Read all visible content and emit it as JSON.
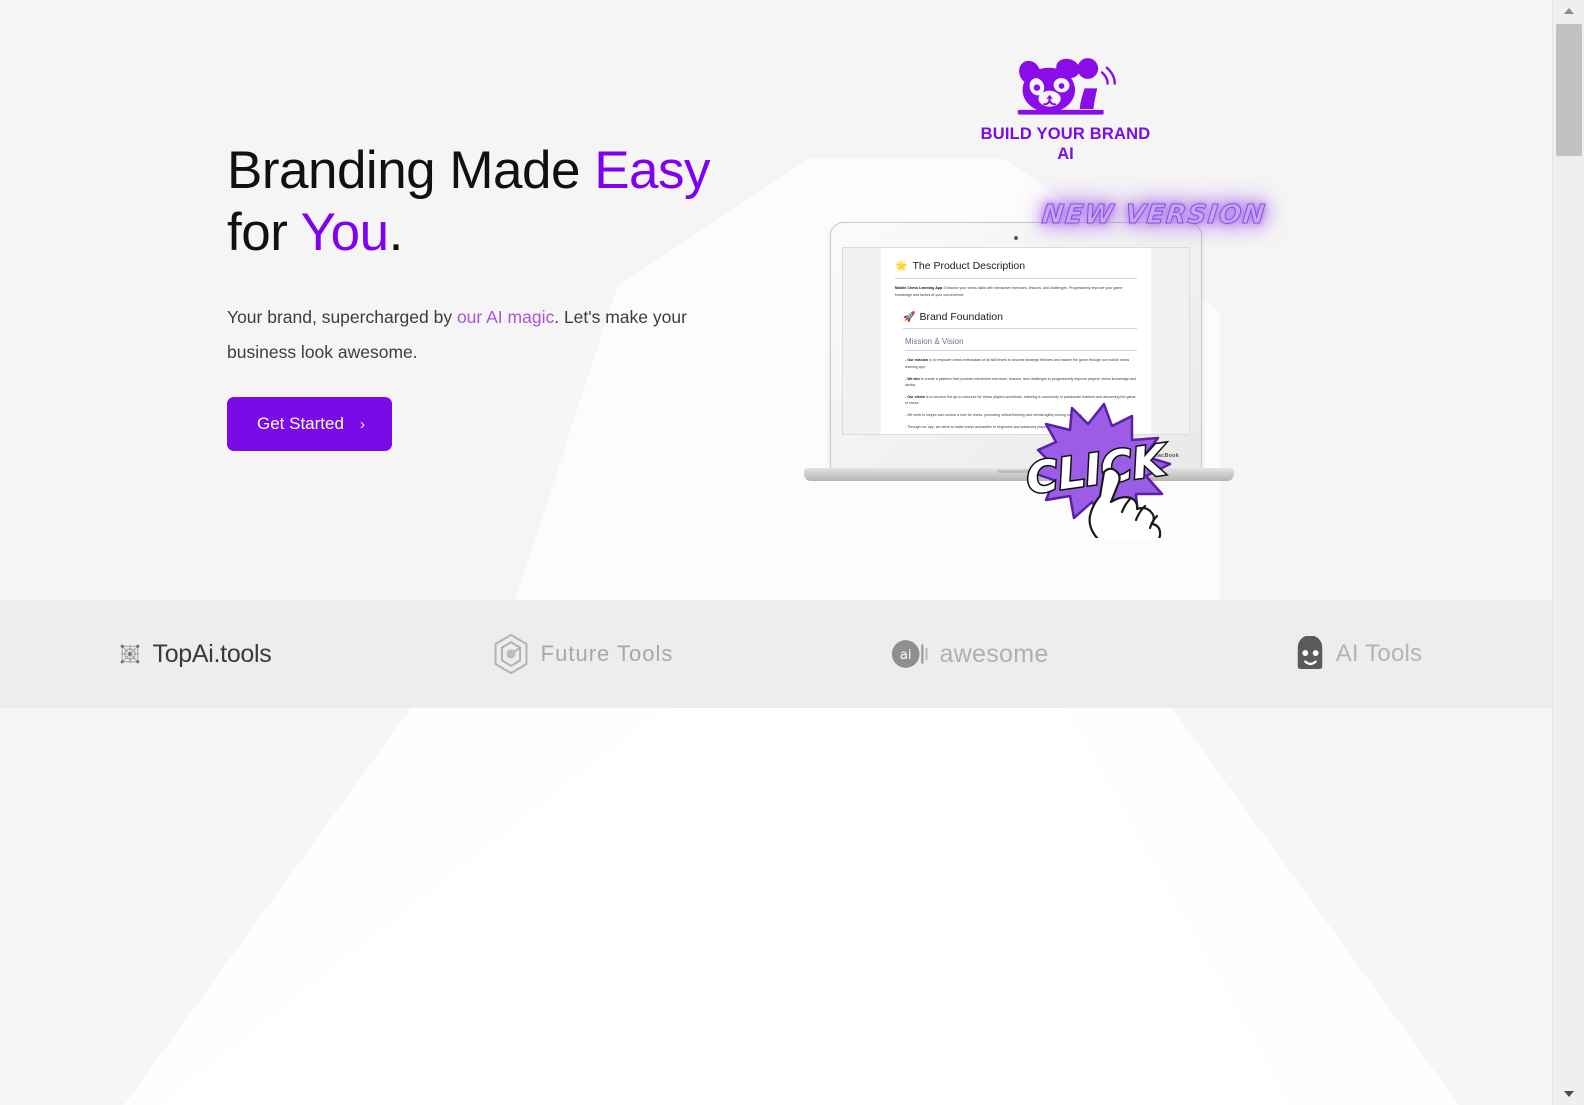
{
  "brand": {
    "logo_line1": "BUILD YOUR BRAND",
    "logo_line2": "AI",
    "logo_icon": "panda-mascot-icon",
    "accent_color": "#8000f0",
    "button_color": "#7a0ae8",
    "link_color": "#a855d8"
  },
  "hero": {
    "headline_part1": "Branding Made ",
    "headline_accent1": "Easy",
    "headline_part2": "for ",
    "headline_accent2": "You",
    "headline_period": ".",
    "subtext_part1": "Your brand, supercharged by ",
    "subtext_link": "our AI magic",
    "subtext_part2": ". Let's make your business look awesome.",
    "cta_label": "Get Started",
    "cta_chevron": "›"
  },
  "mockup": {
    "badge": "NEW VERSION",
    "click_label": "CLICK",
    "laptop_label": "MacBook",
    "document": {
      "title": "The Product Description",
      "title_emoji": "🌟",
      "intro_bold": "Mobile Chess Learning App:",
      "intro_text": " Enhance your chess skills with interactive exercises, lessons, and challenges. Progressively improve your game knowledge and tactics at your convenience.",
      "section_title": "Brand Foundation",
      "section_emoji": "🚀",
      "subsection_title": "Mission & Vision",
      "bullets": [
        {
          "bold": "- Our mission",
          "text": " is to empower chess enthusiasts of all skill levels to become strategic thinkers and master the game through our mobile chess learning app."
        },
        {
          "bold": "- We aim",
          "text": " to create a platform that provides interactive exercises, lessons, and challenges to progressively improve players' chess knowledge and tactics."
        },
        {
          "bold": "- Our vision",
          "text": " is to become the go-to resource for chess players worldwide, fostering a community of passionate learners and advancing the game of chess."
        },
        {
          "bold": "",
          "text": "- We seek to inspire and nurture a love for chess, promoting critical thinking and mental agility among our users."
        },
        {
          "bold": "",
          "text": "- Through our app, we strive to make chess accessible to beginners and advanced players."
        }
      ]
    }
  },
  "partners": [
    {
      "name": "TopAi.tools",
      "icon": "network-nodes-icon"
    },
    {
      "name": "Future Tools",
      "icon": "hexagon-icon"
    },
    {
      "name": "awesome",
      "icon": "ai-circle-badge-icon"
    },
    {
      "name": "AI Tools",
      "icon": "robot-head-icon"
    }
  ],
  "scrollbar": {
    "up_arrow": "scroll-up-arrow",
    "down_arrow": "scroll-down-arrow"
  }
}
